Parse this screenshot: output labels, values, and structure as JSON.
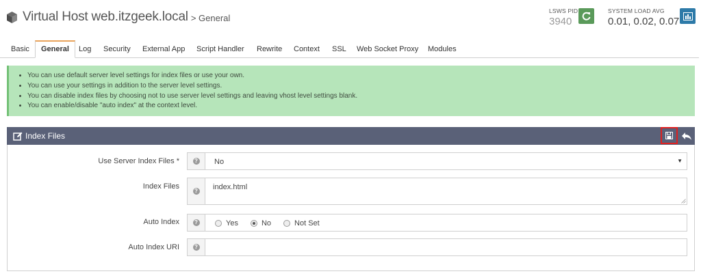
{
  "header": {
    "title": "Virtual Host web.itzgeek.local",
    "breadcrumb": "> General",
    "pid_label": "LSWS PID",
    "pid_value": "3940",
    "load_label": "SYSTEM LOAD AVG",
    "load_value": "0.01, 0.02, 0.07",
    "reload_icon": "refresh-icon",
    "chart_icon": "bar-chart-icon"
  },
  "tabs": [
    {
      "label": "Basic",
      "active": false
    },
    {
      "label": "General",
      "active": true
    },
    {
      "label": "Log",
      "active": false
    },
    {
      "label": "Security",
      "active": false
    },
    {
      "label": "External App",
      "active": false
    },
    {
      "label": "Script Handler",
      "active": false
    },
    {
      "label": "Rewrite",
      "active": false
    },
    {
      "label": "Context",
      "active": false
    },
    {
      "label": "SSL",
      "active": false
    },
    {
      "label": "Web Socket Proxy",
      "active": false
    },
    {
      "label": "Modules",
      "active": false
    }
  ],
  "info": {
    "items": [
      "You can use default server level settings for index files or use your own.",
      "You can use your settings in addition to the server level settings.",
      "You can disable index files by choosing not to use server level settings and leaving vhost level settings blank.",
      "You can enable/disable \"auto index\" at the context level."
    ]
  },
  "panel": {
    "title": "Index Files",
    "fields": {
      "use_server_index": {
        "label": "Use Server Index Files *",
        "value": "No"
      },
      "index_files": {
        "label": "Index Files",
        "value": "index.html"
      },
      "auto_index": {
        "label": "Auto Index",
        "options": [
          "Yes",
          "No",
          "Not Set"
        ],
        "selected": "No"
      },
      "auto_index_uri": {
        "label": "Auto Index URI",
        "value": ""
      }
    }
  },
  "colors": {
    "reload_button": "#5a9a5a",
    "chart_button": "#2d7aa8",
    "info_bg": "#b6e5ba",
    "panel_header": "#5a6178",
    "active_tab_accent": "#e9a35b",
    "save_highlight": "#e02020"
  }
}
